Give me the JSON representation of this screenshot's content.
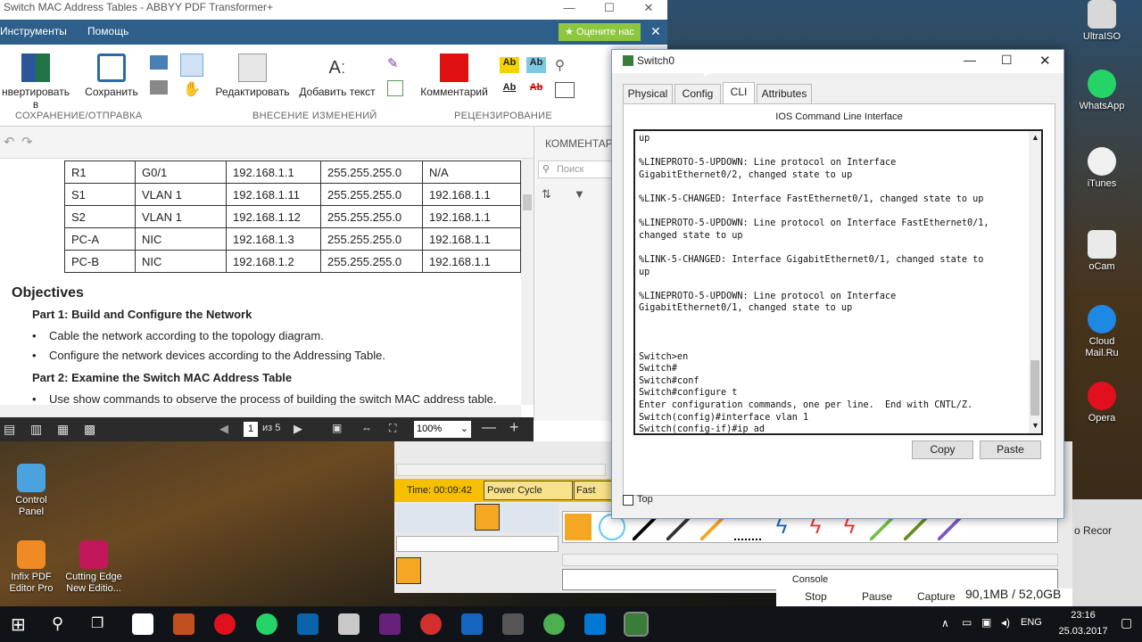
{
  "desktop": {
    "icons_right": [
      {
        "label": "UltraISO"
      },
      {
        "label": "WhatsApp"
      },
      {
        "label": "iTunes"
      },
      {
        "label": "oCam"
      },
      {
        "label": "Cloud Mail.Ru"
      },
      {
        "label": "Opera"
      }
    ],
    "icons_left": [
      {
        "label": "Control Panel"
      },
      {
        "label": "Infix PDF Editor Pro"
      },
      {
        "label": "Cutting Edge New Editio..."
      }
    ]
  },
  "abbyy": {
    "title": "Switch MAC Address Tables - ABBYY PDF Transformer+",
    "menu": [
      "Инструменты",
      "Помощь"
    ],
    "rate": "Оцените нас",
    "ribbon": {
      "convert": "нвертировать в",
      "save": "Сохранить",
      "edit": "Редактировать",
      "add_text": "Добавить текст",
      "comment": "Комментарий"
    },
    "groups": [
      "СОХРАНЕНИЕ/ОТПРАВКА",
      "ВНЕСЕНИЕ ИЗМЕНЕНИЙ",
      "РЕЦЕНЗИРОВАНИЕ"
    ],
    "comments_header": "КОММЕНТАРИ",
    "comments_search": "Поиск коммен",
    "table": [
      [
        "R1",
        "G0/1",
        "192.168.1.1",
        "255.255.255.0",
        "N/A"
      ],
      [
        "S1",
        "VLAN 1",
        "192.168.1.11",
        "255.255.255.0",
        "192.168.1.1"
      ],
      [
        "S2",
        "VLAN 1",
        "192.168.1.12",
        "255.255.255.0",
        "192.168.1.1"
      ],
      [
        "PC-A",
        "NIC",
        "192.168.1.3",
        "255.255.255.0",
        "192.168.1.1"
      ],
      [
        "PC-B",
        "NIC",
        "192.168.1.2",
        "255.255.255.0",
        "192.168.1.1"
      ]
    ],
    "objectives": "Objectives",
    "part1": "Part 1: Build and Configure the Network",
    "bullet1": "Cable the network according to the topology diagram.",
    "bullet2": "Configure the network devices according to the Addressing Table.",
    "part2": "Part 2: Examine the Switch MAC Address Table",
    "bullet3": "Use show commands to observe the process of building the switch MAC address table.",
    "page_current": "1",
    "page_total": "из 5",
    "zoom": "100%"
  },
  "pt": {
    "time": "Time: 00:09:42",
    "power_cycle": "Power Cycle Devices",
    "fast_forward": "Fast Forw",
    "console": "Console",
    "record": "о Recor",
    "stop": "Stop",
    "pause": "Pause",
    "capture": "Capture",
    "size": "90,1MB / 52,0GB"
  },
  "switch": {
    "title": "Switch0",
    "tabs": [
      "Physical",
      "Config",
      "CLI",
      "Attributes"
    ],
    "active_tab": "CLI",
    "heading": "IOS Command Line Interface",
    "cli": "up\n\n%LINEPROTO-5-UPDOWN: Line protocol on Interface\nGigabitEthernet0/2, changed state to up\n\n%LINK-5-CHANGED: Interface FastEthernet0/1, changed state to up\n\n%LINEPROTO-5-UPDOWN: Line protocol on Interface FastEthernet0/1,\nchanged state to up\n\n%LINK-5-CHANGED: Interface GigabitEthernet0/1, changed state to\nup\n\n%LINEPROTO-5-UPDOWN: Line protocol on Interface\nGigabitEthernet0/1, changed state to up\n\n\n\nSwitch>en\nSwitch#\nSwitch#conf\nSwitch#configure t\nEnter configuration commands, one per line.  End with CNTL/Z.\nSwitch(config)#interface vlan 1\nSwitch(config-if)#ip ad\nSwitch(config-if)#ip address",
    "copy": "Copy",
    "paste": "Paste",
    "top": "Top"
  },
  "taskbar": {
    "lang": "ENG",
    "time": "23:16",
    "date": "25.03.2017"
  }
}
